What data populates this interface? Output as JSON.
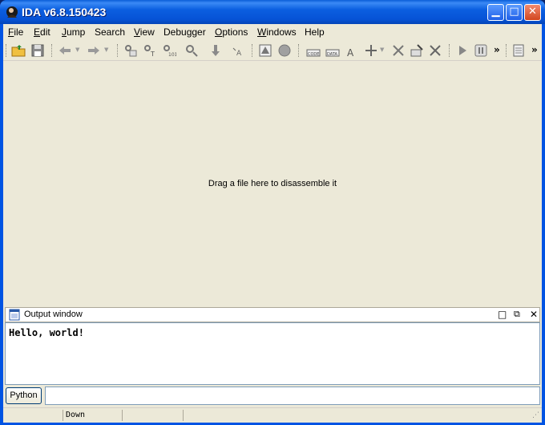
{
  "window": {
    "title": "IDA v6.8.150423"
  },
  "menu": [
    {
      "label": "File",
      "key": "F",
      "rest": "ile"
    },
    {
      "label": "Edit",
      "key": "E",
      "rest": "dit"
    },
    {
      "label": "Jump",
      "key": "J",
      "rest": "ump"
    },
    {
      "label": "Search",
      "key": "",
      "rest": "Search"
    },
    {
      "label": "View",
      "key": "V",
      "rest": "iew"
    },
    {
      "label": "Debugger",
      "key": "",
      "rest": "Debugger"
    },
    {
      "label": "Options",
      "key": "O",
      "rest": "ptions"
    },
    {
      "label": "Windows",
      "key": "W",
      "rest": "indows"
    },
    {
      "label": "Help",
      "key": "",
      "rest": "Help"
    }
  ],
  "main": {
    "message": "Drag a file here to disassemble it"
  },
  "output": {
    "title": "Output window",
    "text": "Hello, world!"
  },
  "python": {
    "label": "Python",
    "value": ""
  },
  "status": {
    "state": "Down"
  },
  "colors": {
    "titlebar": "#0054e3",
    "panel": "#ece9d8",
    "accent_folder": "#f0c040"
  }
}
